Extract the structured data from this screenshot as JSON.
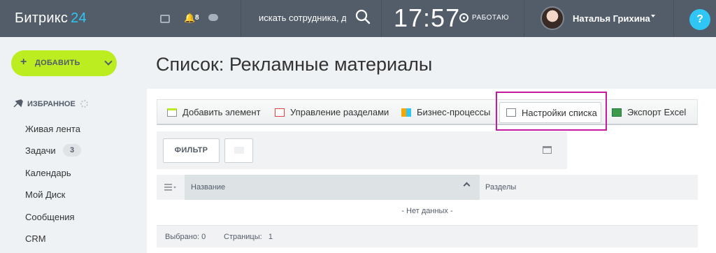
{
  "header": {
    "brand": "Битрикс",
    "brand_num": "24",
    "notifications_count": "8",
    "search_placeholder": "искать сотрудника, документ",
    "clock": "17:57",
    "status": "РАБОТАЮ",
    "user_name": "Наталья Грихина",
    "help": "?"
  },
  "sidebar": {
    "add_label": "ДОБАВИТЬ",
    "favorites_label": "ИЗБРАННОЕ",
    "items": [
      {
        "label": "Живая лента"
      },
      {
        "label": "Задачи",
        "counter": "3"
      },
      {
        "label": "Календарь"
      },
      {
        "label": "Мой Диск"
      },
      {
        "label": "Сообщения"
      },
      {
        "label": "CRM"
      }
    ]
  },
  "main": {
    "title": "Список: Рекламные материалы",
    "toolbar": {
      "add_element": "Добавить элемент",
      "manage_sections": "Управление разделами",
      "business_processes": "Бизнес-процессы",
      "list_settings": "Настройки списка",
      "export_excel": "Экспорт Excel"
    },
    "filter_label": "ФИЛЬТР",
    "grid": {
      "col_name": "Название",
      "col_sections": "Разделы",
      "empty": "- Нет данных -",
      "selected": "Выбрано: 0",
      "pages": "Страницы:   1"
    }
  },
  "colors": {
    "topbar": "#535c69",
    "accent": "#2fc6f6",
    "add_button": "#bbed21",
    "highlight": "#c51b9e"
  }
}
